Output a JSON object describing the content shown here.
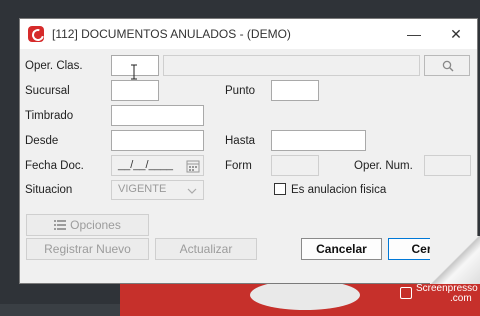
{
  "window": {
    "title": "[112] DOCUMENTOS ANULADOS - (DEMO)",
    "minimize": "—",
    "close": "✕"
  },
  "form": {
    "oper_clas_label": "Oper. Clas.",
    "sucursal_label": "Sucursal",
    "punto_label": "Punto",
    "timbrado_label": "Timbrado",
    "desde_label": "Desde",
    "hasta_label": "Hasta",
    "fecha_doc_label": "Fecha Doc.",
    "fecha_doc_value": "__/__/____",
    "form_label": "Form",
    "oper_num_label": "Oper. Num.",
    "situacion_label": "Situacion",
    "situacion_value": "VIGENTE",
    "anulacion_label": "Es anulacion fisica"
  },
  "buttons": {
    "opciones": "Opciones",
    "registrar": "Registrar Nuevo",
    "actualizar": "Actualizar",
    "cancelar": "Cancelar",
    "cerrar": "Cerrar"
  },
  "watermark": {
    "brand": "Screenpresso",
    "site": ".com"
  }
}
